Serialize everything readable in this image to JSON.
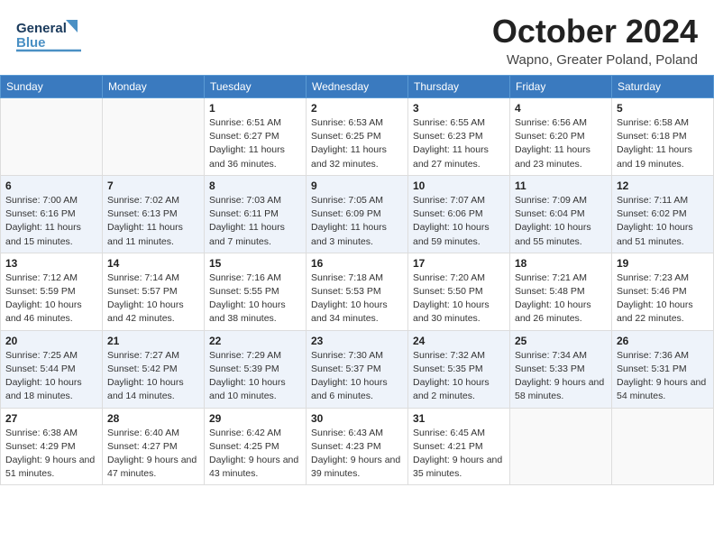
{
  "header": {
    "logo_general": "General",
    "logo_blue": "Blue",
    "month_title": "October 2024",
    "location": "Wapno, Greater Poland, Poland"
  },
  "weekdays": [
    "Sunday",
    "Monday",
    "Tuesday",
    "Wednesday",
    "Thursday",
    "Friday",
    "Saturday"
  ],
  "weeks": [
    [
      {
        "day": "",
        "info": ""
      },
      {
        "day": "",
        "info": ""
      },
      {
        "day": "1",
        "info": "Sunrise: 6:51 AM\nSunset: 6:27 PM\nDaylight: 11 hours and 36 minutes."
      },
      {
        "day": "2",
        "info": "Sunrise: 6:53 AM\nSunset: 6:25 PM\nDaylight: 11 hours and 32 minutes."
      },
      {
        "day": "3",
        "info": "Sunrise: 6:55 AM\nSunset: 6:23 PM\nDaylight: 11 hours and 27 minutes."
      },
      {
        "day": "4",
        "info": "Sunrise: 6:56 AM\nSunset: 6:20 PM\nDaylight: 11 hours and 23 minutes."
      },
      {
        "day": "5",
        "info": "Sunrise: 6:58 AM\nSunset: 6:18 PM\nDaylight: 11 hours and 19 minutes."
      }
    ],
    [
      {
        "day": "6",
        "info": "Sunrise: 7:00 AM\nSunset: 6:16 PM\nDaylight: 11 hours and 15 minutes."
      },
      {
        "day": "7",
        "info": "Sunrise: 7:02 AM\nSunset: 6:13 PM\nDaylight: 11 hours and 11 minutes."
      },
      {
        "day": "8",
        "info": "Sunrise: 7:03 AM\nSunset: 6:11 PM\nDaylight: 11 hours and 7 minutes."
      },
      {
        "day": "9",
        "info": "Sunrise: 7:05 AM\nSunset: 6:09 PM\nDaylight: 11 hours and 3 minutes."
      },
      {
        "day": "10",
        "info": "Sunrise: 7:07 AM\nSunset: 6:06 PM\nDaylight: 10 hours and 59 minutes."
      },
      {
        "day": "11",
        "info": "Sunrise: 7:09 AM\nSunset: 6:04 PM\nDaylight: 10 hours and 55 minutes."
      },
      {
        "day": "12",
        "info": "Sunrise: 7:11 AM\nSunset: 6:02 PM\nDaylight: 10 hours and 51 minutes."
      }
    ],
    [
      {
        "day": "13",
        "info": "Sunrise: 7:12 AM\nSunset: 5:59 PM\nDaylight: 10 hours and 46 minutes."
      },
      {
        "day": "14",
        "info": "Sunrise: 7:14 AM\nSunset: 5:57 PM\nDaylight: 10 hours and 42 minutes."
      },
      {
        "day": "15",
        "info": "Sunrise: 7:16 AM\nSunset: 5:55 PM\nDaylight: 10 hours and 38 minutes."
      },
      {
        "day": "16",
        "info": "Sunrise: 7:18 AM\nSunset: 5:53 PM\nDaylight: 10 hours and 34 minutes."
      },
      {
        "day": "17",
        "info": "Sunrise: 7:20 AM\nSunset: 5:50 PM\nDaylight: 10 hours and 30 minutes."
      },
      {
        "day": "18",
        "info": "Sunrise: 7:21 AM\nSunset: 5:48 PM\nDaylight: 10 hours and 26 minutes."
      },
      {
        "day": "19",
        "info": "Sunrise: 7:23 AM\nSunset: 5:46 PM\nDaylight: 10 hours and 22 minutes."
      }
    ],
    [
      {
        "day": "20",
        "info": "Sunrise: 7:25 AM\nSunset: 5:44 PM\nDaylight: 10 hours and 18 minutes."
      },
      {
        "day": "21",
        "info": "Sunrise: 7:27 AM\nSunset: 5:42 PM\nDaylight: 10 hours and 14 minutes."
      },
      {
        "day": "22",
        "info": "Sunrise: 7:29 AM\nSunset: 5:39 PM\nDaylight: 10 hours and 10 minutes."
      },
      {
        "day": "23",
        "info": "Sunrise: 7:30 AM\nSunset: 5:37 PM\nDaylight: 10 hours and 6 minutes."
      },
      {
        "day": "24",
        "info": "Sunrise: 7:32 AM\nSunset: 5:35 PM\nDaylight: 10 hours and 2 minutes."
      },
      {
        "day": "25",
        "info": "Sunrise: 7:34 AM\nSunset: 5:33 PM\nDaylight: 9 hours and 58 minutes."
      },
      {
        "day": "26",
        "info": "Sunrise: 7:36 AM\nSunset: 5:31 PM\nDaylight: 9 hours and 54 minutes."
      }
    ],
    [
      {
        "day": "27",
        "info": "Sunrise: 6:38 AM\nSunset: 4:29 PM\nDaylight: 9 hours and 51 minutes."
      },
      {
        "day": "28",
        "info": "Sunrise: 6:40 AM\nSunset: 4:27 PM\nDaylight: 9 hours and 47 minutes."
      },
      {
        "day": "29",
        "info": "Sunrise: 6:42 AM\nSunset: 4:25 PM\nDaylight: 9 hours and 43 minutes."
      },
      {
        "day": "30",
        "info": "Sunrise: 6:43 AM\nSunset: 4:23 PM\nDaylight: 9 hours and 39 minutes."
      },
      {
        "day": "31",
        "info": "Sunrise: 6:45 AM\nSunset: 4:21 PM\nDaylight: 9 hours and 35 minutes."
      },
      {
        "day": "",
        "info": ""
      },
      {
        "day": "",
        "info": ""
      }
    ]
  ]
}
